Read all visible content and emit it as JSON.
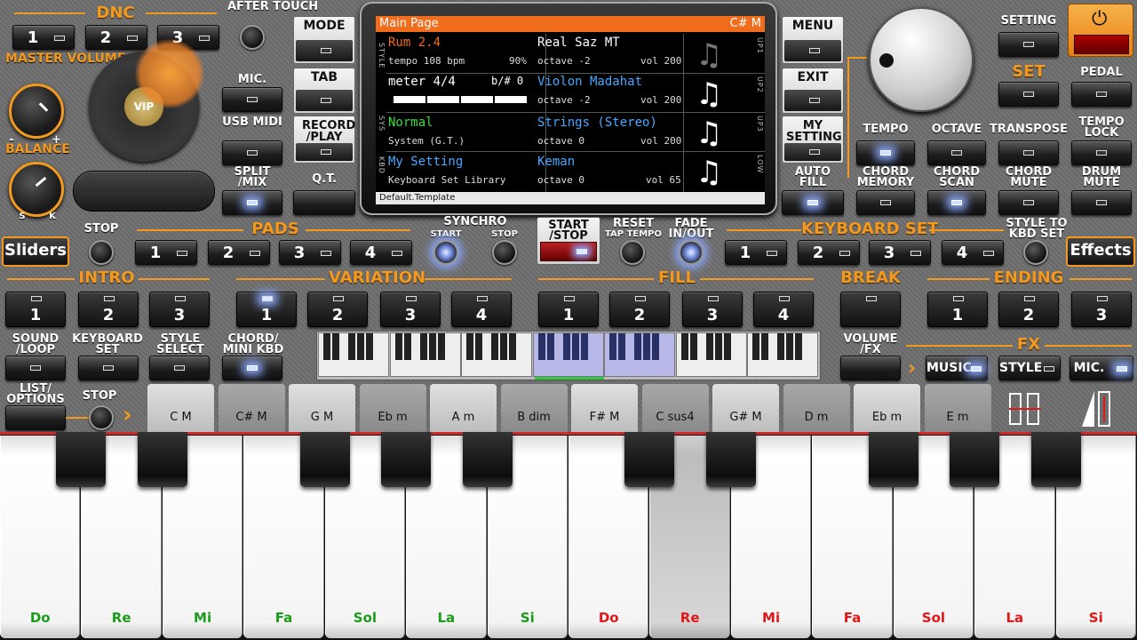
{
  "dnc": {
    "title": "DNC",
    "buttons": [
      "1",
      "2",
      "3"
    ]
  },
  "after_touch": "AFTER TOUCH",
  "master_volume": "MASTER VOLUME",
  "balance": {
    "title": "BALANCE",
    "minus": "-",
    "plus": "+",
    "s": "S",
    "k": "K"
  },
  "vip": "VIP",
  "mic": "MIC.",
  "usb_midi": "USB MIDI",
  "split_mix": "SPLIT /MIX",
  "white_buttons": {
    "mode": "MODE",
    "tab": "TAB",
    "record": "RECORD /PLAY",
    "qt": "Q.T."
  },
  "screen": {
    "header_left": "Main Page",
    "header_right": "C# M",
    "style_name": "Rum 2.4",
    "tempo": "tempo 108 bpm",
    "style_volume": "90%",
    "meter": "meter 4/4",
    "transpose": "b/# 0",
    "sys_name": "Normal",
    "sys_sub": "System (G.T.)",
    "kbd_name": "My Setting",
    "kbd_sub": "Keyboard Set Library",
    "upper": [
      {
        "name": "Real Saz MT",
        "octave": "octave -2",
        "vol": "vol 200"
      },
      {
        "name": "Violon Madahat",
        "octave": "octave -2",
        "vol": "vol 200"
      },
      {
        "name": "Strings (Stereo)",
        "octave": "octave 0",
        "vol": "vol 200"
      },
      {
        "name": "Keman",
        "octave": "octave 0",
        "vol": "vol 65"
      }
    ],
    "footer": "Default.Template",
    "side_left": [
      "STYLE",
      "SYS",
      "KBD"
    ],
    "side_right": [
      "UP1",
      "UP2",
      "UP3",
      "LOW"
    ]
  },
  "right_buttons": {
    "menu": "MENU",
    "exit": "EXIT",
    "my_setting": "MY SETTING",
    "auto_fill": "AUTO FILL"
  },
  "setting": "SETTING",
  "set": "SET",
  "pedal": "PEDAL",
  "tempo": "TEMPO",
  "octave": "OCTAVE",
  "transpose": "TRANSPOSE",
  "tempo_lock": "TEMPO LOCK",
  "chord_memory": "CHORD MEMORY",
  "chord_scan": "CHORD SCAN",
  "chord_mute": "CHORD MUTE",
  "drum_mute": "DRUM MUTE",
  "sliders": "Sliders",
  "stop": "STOP",
  "pads": {
    "title": "PADS",
    "buttons": [
      "1",
      "2",
      "3",
      "4"
    ]
  },
  "synchro": {
    "title": "SYNCHRO",
    "start": "START",
    "stop": "STOP"
  },
  "start_stop": "START /STOP",
  "reset": "RESET",
  "tap_tempo": "TAP TEMPO",
  "fade": "FADE IN/OUT",
  "keyboard_set": {
    "title": "KEYBOARD SET",
    "buttons": [
      "1",
      "2",
      "3",
      "4"
    ]
  },
  "style_to_kbd": "STYLE TO KBD SET",
  "effects": "Effects",
  "intro": {
    "title": "INTRO",
    "buttons": [
      "1",
      "2",
      "3"
    ]
  },
  "variation": {
    "title": "VARIATION",
    "buttons": [
      "1",
      "2",
      "3",
      "4"
    ]
  },
  "fill": {
    "title": "FILL",
    "buttons": [
      "1",
      "2",
      "3",
      "4"
    ]
  },
  "break": "BREAK",
  "ending": {
    "title": "ENDING",
    "buttons": [
      "1",
      "2",
      "3"
    ]
  },
  "sound_loop": "SOUND /LOOP",
  "keyboard_set_lbl": "KEYBOARD SET",
  "style_select": "STYLE SELECT",
  "chord_mini": "CHORD/ MINI KBD",
  "volume_fx": "VOLUME /FX",
  "fx": "FX",
  "music": "MUSIC",
  "style": "STYLE",
  "mic_fx": "MIC.",
  "list_options": "LIST/ OPTIONS",
  "stop2": "STOP",
  "chords": [
    "C M",
    "C# M",
    "G M",
    "Eb m",
    "A m",
    "B dim",
    "F# M",
    "C sus4",
    "G# M",
    "D m",
    "Eb m",
    "E m"
  ],
  "notes": [
    "Do",
    "Re",
    "Mi",
    "Fa",
    "Sol",
    "La",
    "Si",
    "Do",
    "Re",
    "Mi",
    "Fa",
    "Sol",
    "La",
    "Si"
  ],
  "colors": {
    "accent": "#f39a1e",
    "note_green": "#1a9c1a",
    "note_red": "#e01818",
    "lcd_orange": "#f06d1d",
    "lcd_blue": "#48a8ff",
    "lcd_green": "#3cdc3c"
  }
}
